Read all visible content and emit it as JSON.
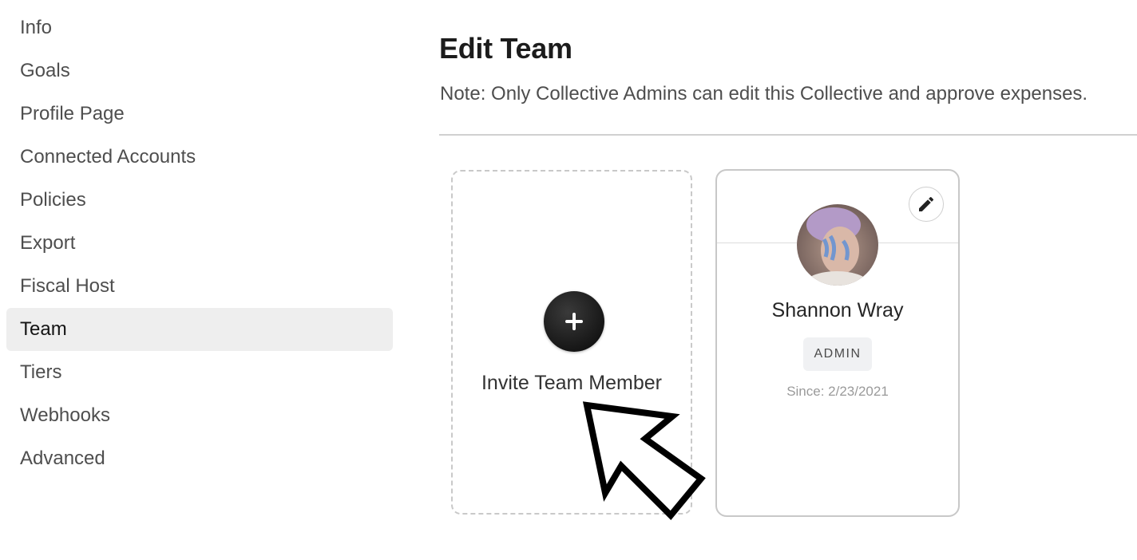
{
  "sidebar": {
    "items": [
      {
        "label": "Info",
        "active": false
      },
      {
        "label": "Goals",
        "active": false
      },
      {
        "label": "Profile Page",
        "active": false
      },
      {
        "label": "Connected Accounts",
        "active": false
      },
      {
        "label": "Policies",
        "active": false
      },
      {
        "label": "Export",
        "active": false
      },
      {
        "label": "Fiscal Host",
        "active": false
      },
      {
        "label": "Team",
        "active": true
      },
      {
        "label": "Tiers",
        "active": false
      },
      {
        "label": "Webhooks",
        "active": false
      },
      {
        "label": "Advanced",
        "active": false
      }
    ]
  },
  "main": {
    "title": "Edit Team",
    "note": "Note: Only Collective Admins can edit this Collective and approve expenses.",
    "invite_card": {
      "icon": "plus-icon",
      "label": "Invite Team Member"
    },
    "members": [
      {
        "name": "Shannon Wray",
        "role": "ADMIN",
        "since": "Since: 2/23/2021",
        "edit_icon": "pencil-icon"
      }
    ]
  },
  "annotation": {
    "icon": "cursor-arrow-icon"
  }
}
